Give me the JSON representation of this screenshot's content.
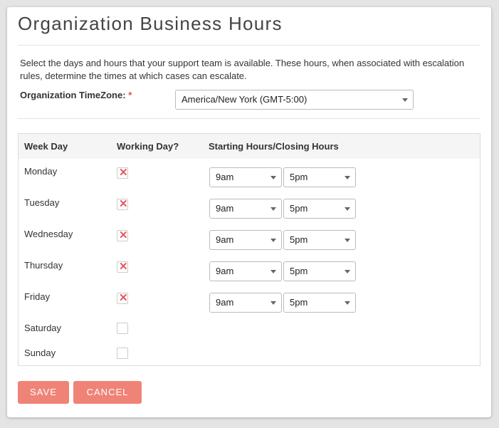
{
  "page": {
    "title": "Organization Business Hours"
  },
  "description": "Select the days and hours that your support team is available. These hours, when associated with escalation rules, determine the times at which cases can escalate.",
  "timezone": {
    "label": "Organization TimeZone:",
    "required_marker": "*",
    "value": "America/New York (GMT-5:00)"
  },
  "table": {
    "headers": {
      "day": "Week Day",
      "working": "Working Day?",
      "hours": "Starting Hours/Closing Hours"
    },
    "rows": [
      {
        "day": "Monday",
        "working": true,
        "start": "9am",
        "end": "5pm"
      },
      {
        "day": "Tuesday",
        "working": true,
        "start": "9am",
        "end": "5pm"
      },
      {
        "day": "Wednesday",
        "working": true,
        "start": "9am",
        "end": "5pm"
      },
      {
        "day": "Thursday",
        "working": true,
        "start": "9am",
        "end": "5pm"
      },
      {
        "day": "Friday",
        "working": true,
        "start": "9am",
        "end": "5pm"
      },
      {
        "day": "Saturday",
        "working": false
      },
      {
        "day": "Sunday",
        "working": false
      }
    ]
  },
  "buttons": {
    "save": "SAVE",
    "cancel": "CANCEL"
  },
  "colors": {
    "accent": "#f08377",
    "check_mark": "#e8565a",
    "required": "#d9534f"
  }
}
